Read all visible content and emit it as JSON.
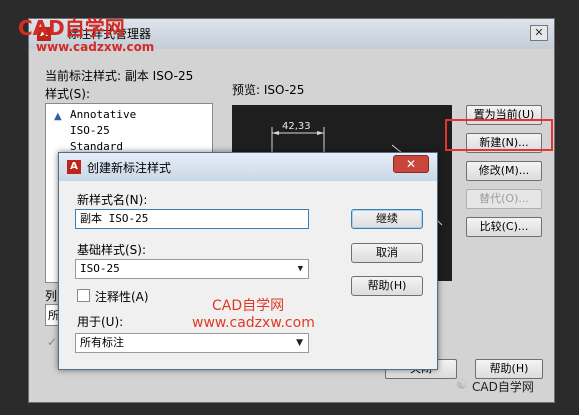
{
  "watermarks": {
    "top_logo": "CAD自学网",
    "top_url": "www.cadzxw.com",
    "center_name": "CAD自学网",
    "center_url": "www.cadzxw.com",
    "footer": "CAD自学网"
  },
  "outer": {
    "title": "标注样式管理器",
    "current_style_label": "当前标注样式: 副本 ISO-25",
    "styles_label": "样式(S):",
    "styles": [
      "Annotative",
      "ISO-25",
      "Standard"
    ],
    "preview_label": "预览: ISO-25",
    "preview_dimension": "42,33",
    "list_label": "列",
    "list_value": "所",
    "buttons": {
      "set_current": "置为当前(U)",
      "new": "新建(N)...",
      "modify": "修改(M)...",
      "override": "替代(O)...",
      "compare": "比较(C)...",
      "close": "关闭",
      "help": "帮助(H)"
    }
  },
  "inner": {
    "title": "创建新标注样式",
    "new_name_label": "新样式名(N):",
    "new_name_value": "副本 ISO-25",
    "base_style_label": "基础样式(S):",
    "base_style_value": "ISO-25",
    "annotative_label": "注释性(A)",
    "use_for_label": "用于(U):",
    "use_for_value": "所有标注",
    "buttons": {
      "continue": "继续",
      "cancel": "取消",
      "help": "帮助(H)"
    }
  },
  "colors": {
    "highlight": "#e5342f",
    "watermark": "#d32b24"
  }
}
